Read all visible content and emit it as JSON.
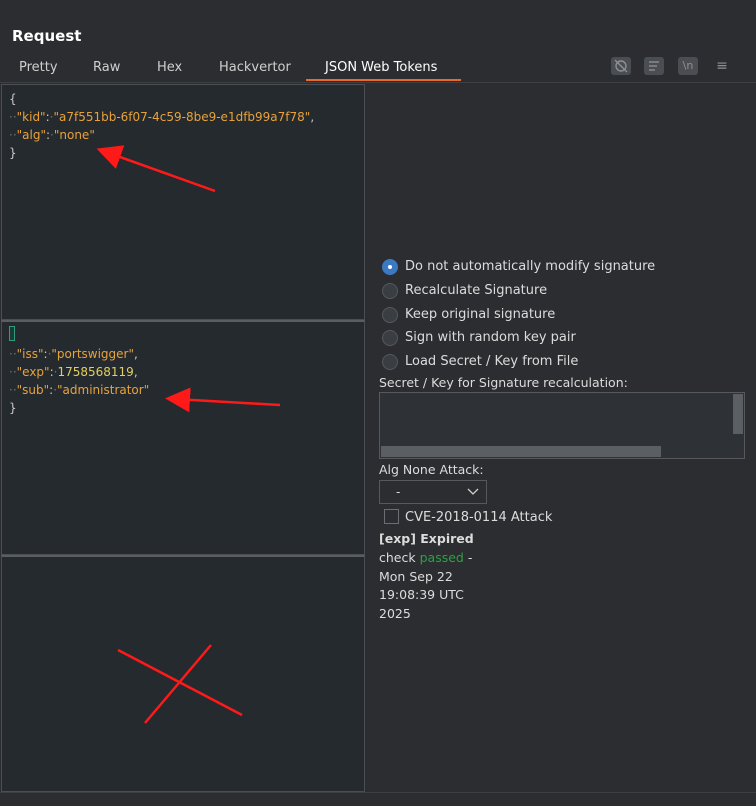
{
  "title": "Request",
  "tabs": [
    {
      "label": "Pretty"
    },
    {
      "label": "Raw"
    },
    {
      "label": "Hex"
    },
    {
      "label": "Hackvertor"
    },
    {
      "label": "JSON Web Tokens"
    }
  ],
  "toolbar": {
    "icons": [
      "hide-icon",
      "wrap-icon",
      "newline-icon",
      "menu-icon"
    ],
    "newline_label": "\\n",
    "menu_glyph": "≡"
  },
  "header_json": {
    "open": "{",
    "kid_key": "\"kid\"",
    "kid_value": "\"a7f551bb-6f07-4c59-8be9-e1dfb99a7f78\"",
    "alg_key": "\"alg\"",
    "alg_value": "\"none\"",
    "close": "}"
  },
  "payload_json": {
    "open": "{",
    "iss_key": "\"iss\"",
    "iss_value": "\"portswigger\"",
    "exp_key": "\"exp\"",
    "exp_value": "1758568119",
    "sub_key": "\"sub\"",
    "sub_value": "\"administrator\"",
    "close": "}"
  },
  "signature_options": [
    {
      "label": "Do not automatically modify signature",
      "selected": true
    },
    {
      "label": "Recalculate Signature",
      "selected": false
    },
    {
      "label": "Keep original signature",
      "selected": false
    },
    {
      "label": "Sign with random key pair",
      "selected": false
    },
    {
      "label": "Load Secret / Key from File",
      "selected": false
    }
  ],
  "secret_label": "Secret / Key for Signature recalculation:",
  "secret_value": "",
  "alg_none_label": "Alg None Attack:",
  "alg_none_selected": "-",
  "cve_label": "CVE-2018-0114 Attack",
  "cve_checked": false,
  "exp_status": {
    "title": "[exp] Expired",
    "check_prefix": "check",
    "check_status": "passed",
    "dash": "-",
    "date_line1": "Mon Sep 22",
    "date_line2": "19:08:39 UTC",
    "date_line3": "2025"
  },
  "colors": {
    "accent": "#e8692b",
    "radio_selected": "#3c79c4",
    "passed": "#2ea043",
    "json_string": "#e8a23b",
    "annotation": "#ff1a1a"
  }
}
